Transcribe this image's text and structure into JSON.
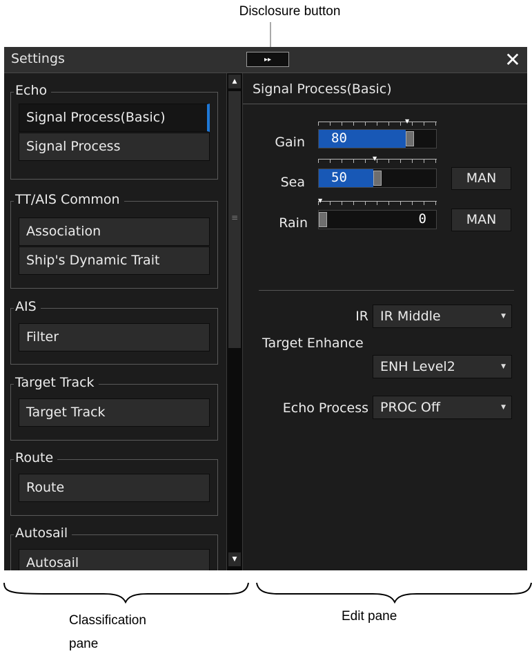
{
  "annotations": {
    "disclosure": "Disclosure button",
    "classification_line1": "Classification",
    "classification_line2": "pane",
    "edit": "Edit pane"
  },
  "window": {
    "title": "Settings",
    "disclosure_glyph": "▸▸",
    "close_glyph": "✕"
  },
  "classification": {
    "groups": [
      {
        "label": "Echo",
        "items": [
          "Signal Process(Basic)",
          "Signal Process"
        ]
      },
      {
        "label": "TT/AIS Common",
        "items": [
          "Association",
          "Ship's Dynamic Trait"
        ]
      },
      {
        "label": "AIS",
        "items": [
          "Filter"
        ]
      },
      {
        "label": "Target Track",
        "items": [
          "Target Track"
        ]
      },
      {
        "label": "Route",
        "items": [
          "Route"
        ]
      },
      {
        "label": "Autosail",
        "items": [
          "Autosail"
        ]
      }
    ],
    "selected": "Signal Process(Basic)",
    "scroll_up_glyph": "▲",
    "scroll_down_glyph": "▼",
    "scroll_grip_glyph": "≡"
  },
  "edit": {
    "title": "Signal Process(Basic)",
    "gain": {
      "label": "Gain",
      "value": "80",
      "level": 0.8
    },
    "sea": {
      "label": "Sea",
      "value": "50",
      "level": 0.5,
      "mode": "MAN"
    },
    "rain": {
      "label": "Rain",
      "value": "0",
      "level": 0.0,
      "mode": "MAN"
    },
    "ir": {
      "label": "IR",
      "value": "IR Middle"
    },
    "target_enhance": {
      "label": "Target Enhance",
      "value": "ENH Level2"
    },
    "echo_process": {
      "label": "Echo Process",
      "value": "PROC Off"
    },
    "dropdown_arrow": "▼",
    "marker_glyph": "▼"
  },
  "colors": {
    "accent": "#1e78d8",
    "slider_fill": "#1858b6",
    "window_bg": "#1c1c1c"
  }
}
